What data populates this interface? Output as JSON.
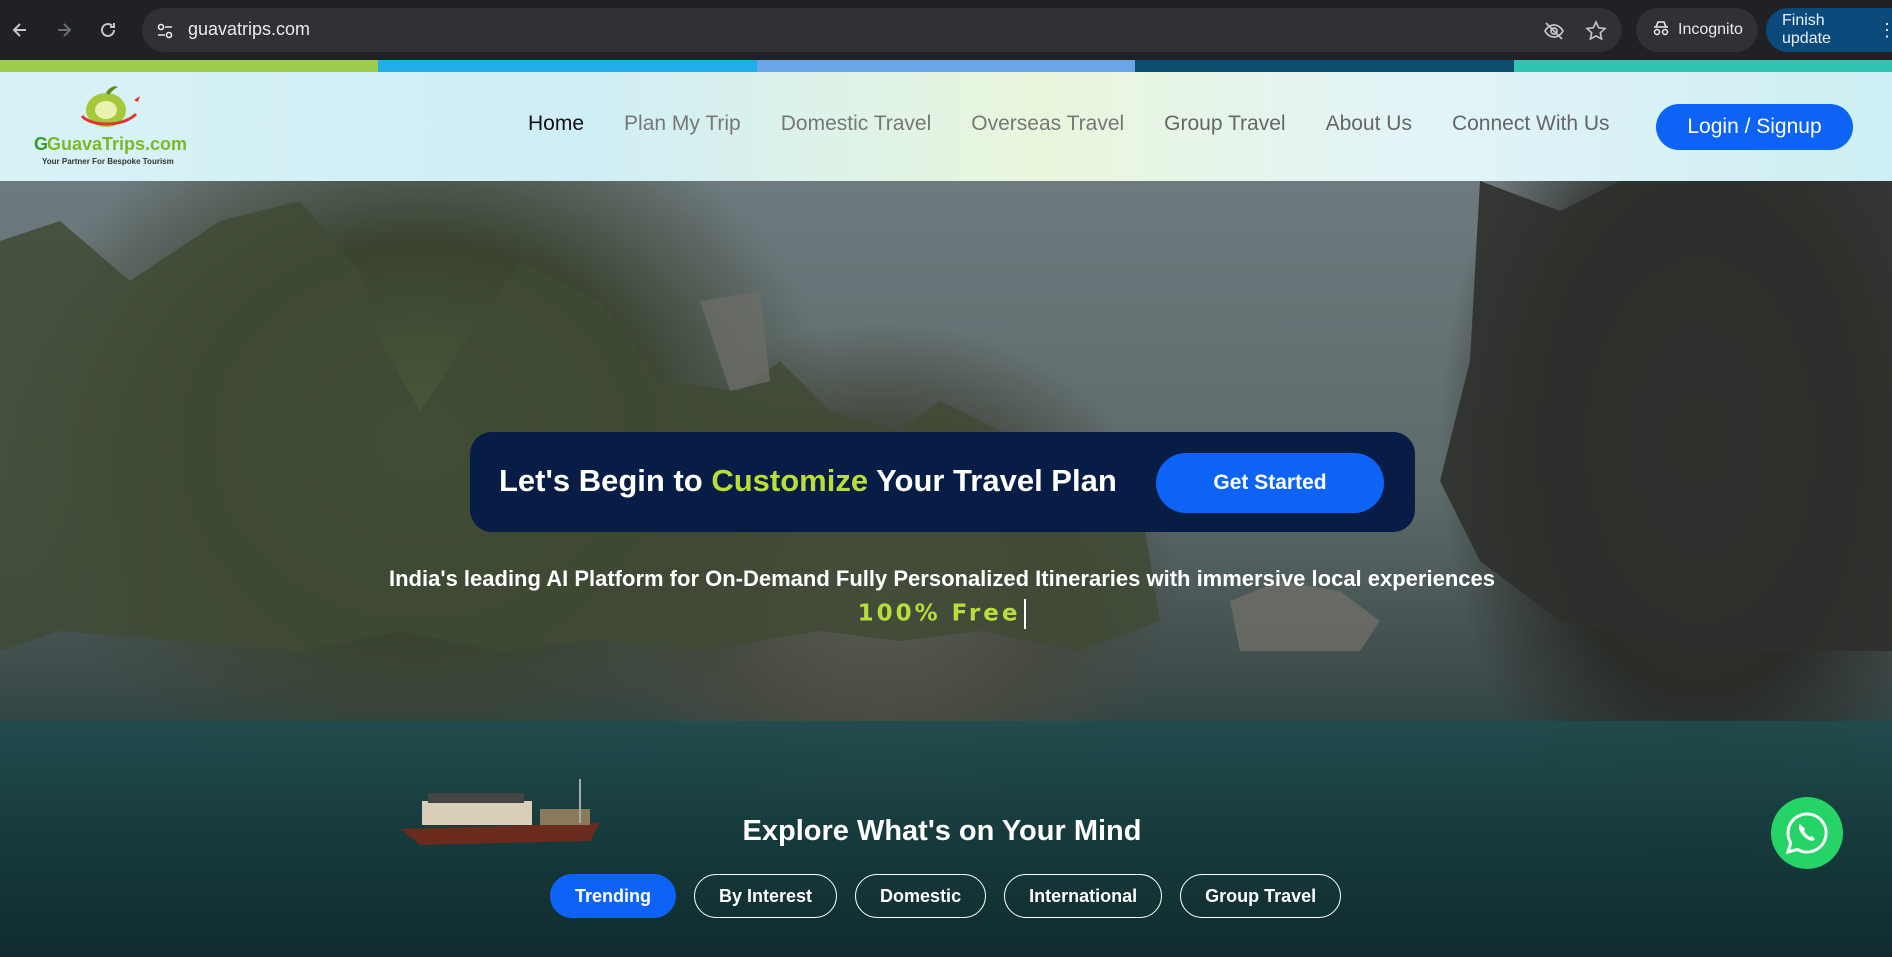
{
  "browser": {
    "url": "guavatrips.com",
    "incognito_label": "Incognito",
    "update_label": "Finish update",
    "icons": [
      "back-icon",
      "forward-icon",
      "reload-icon",
      "site-settings-icon",
      "eye-off-icon",
      "star-icon",
      "incognito-icon",
      "more-icon"
    ]
  },
  "strip_colors": [
    "#9ccc4c",
    "#1eaee8",
    "#6aa5e8",
    "#0d4d6f",
    "#2fc5b2"
  ],
  "header": {
    "logo_text": "GuavaTrips.com",
    "logo_tagline": "Your Partner For Bespoke Tourism",
    "menu": [
      {
        "label": "Home",
        "active": true
      },
      {
        "label": "Plan My Trip"
      },
      {
        "label": "Domestic Travel"
      },
      {
        "label": "Overseas Travel"
      },
      {
        "label": "Group Travel"
      },
      {
        "label": "About Us"
      },
      {
        "label": "Connect With Us"
      }
    ],
    "login_label": "Login / Signup"
  },
  "hero": {
    "cta_prefix": "Let's Begin to ",
    "cta_highlight": "Customize",
    "cta_suffix": " Your Travel Plan",
    "cta_button": "Get Started",
    "tagline": "India's leading AI Platform for On-Demand Fully Personalized Itineraries with immersive local experiences",
    "free_text": "100% Free",
    "explore_title": "Explore What's on Your Mind",
    "chips": [
      {
        "label": "Trending",
        "active": true
      },
      {
        "label": "By Interest"
      },
      {
        "label": "Domestic"
      },
      {
        "label": "International"
      },
      {
        "label": "Group Travel"
      }
    ]
  },
  "colors": {
    "accent_blue": "#0d63f6",
    "highlight_green": "#b9dd3a",
    "cta_bg": "#071d45",
    "whatsapp": "#25d366"
  }
}
